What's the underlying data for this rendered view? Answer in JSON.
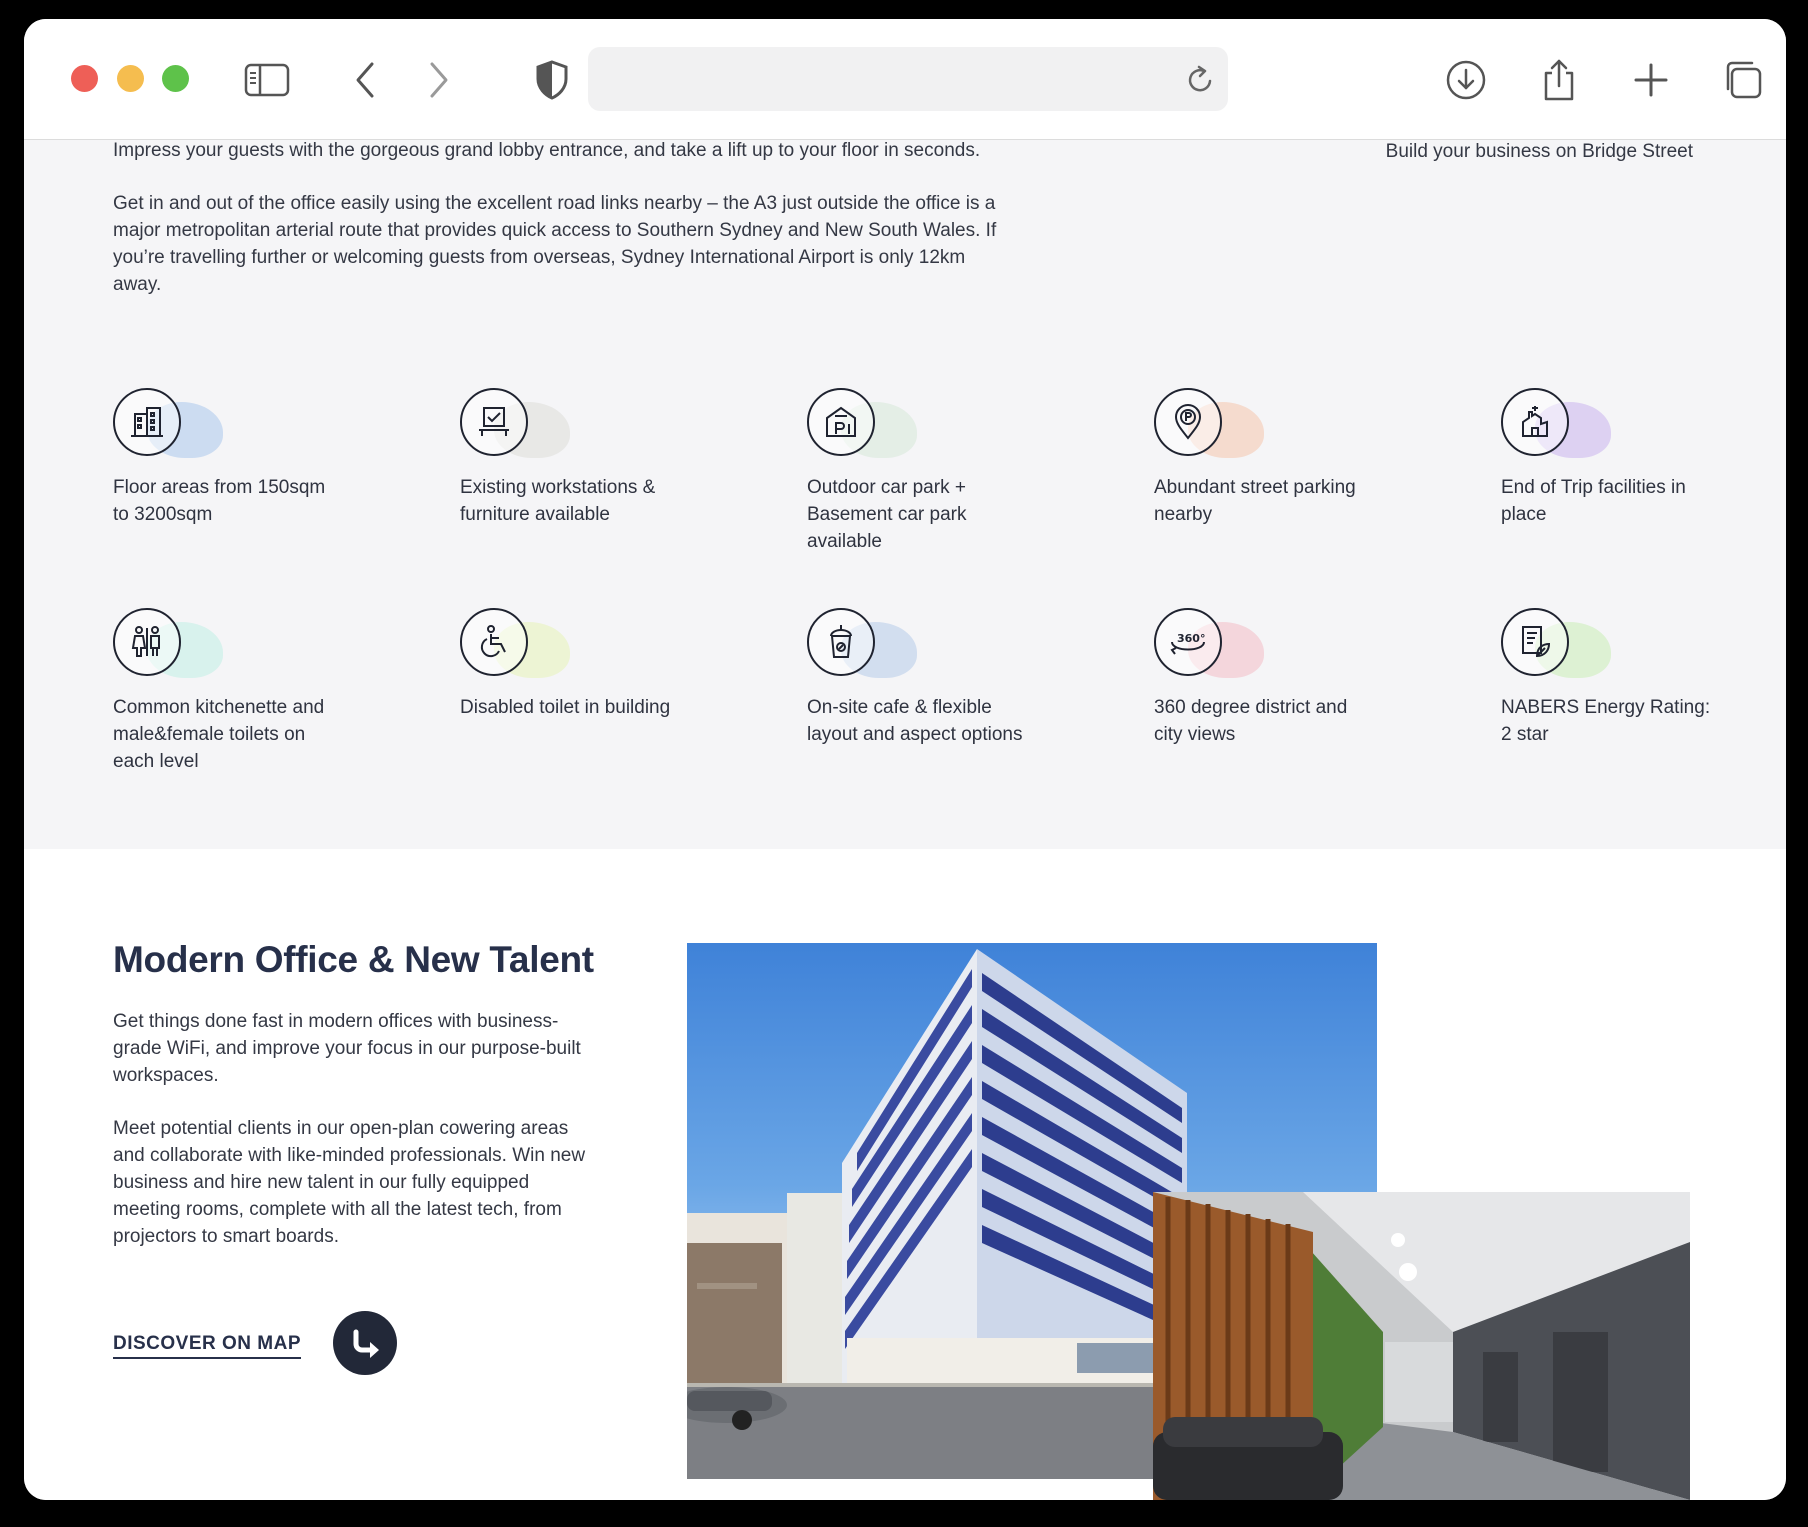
{
  "browser": {
    "url": "",
    "icons": [
      "sidebar-icon",
      "back-icon",
      "forward-icon",
      "privacy-shield-icon",
      "reload-icon",
      "download-icon",
      "share-icon",
      "new-tab-icon",
      "tabs-overview-icon"
    ]
  },
  "intro": {
    "paragraph1": "Impress your guests with the gorgeous grand lobby entrance, and take a lift up to your floor in seconds.",
    "paragraph2": "Get in and out of the office easily using the excellent road links nearby – the A3 just outside the office is a major metropolitan arterial route that provides quick access to Southern Sydney and New South Wales. If you’re travelling further or welcoming guests from overseas, Sydney International Airport is only 12km away.",
    "side_note": "Build your business on Bridge Street"
  },
  "features": [
    {
      "label": "Floor areas from 150sqm to 3200sqm",
      "icon": "building-icon",
      "color": "#a9c6ec"
    },
    {
      "label": "Existing workstations & furniture available",
      "icon": "workstation-icon",
      "color": "#dcdcd8"
    },
    {
      "label": "Outdoor car park + Basement car park available",
      "icon": "car-park-icon",
      "color": "#d6e8d9"
    },
    {
      "label": "Abundant street parking nearby",
      "icon": "parking-pin-icon",
      "color": "#f4c5ad"
    },
    {
      "label": "End of Trip facilities in place",
      "icon": "facilities-icon",
      "color": "#c9b3ef"
    },
    {
      "label": "Common kitchenette and male&female toilets on each level",
      "icon": "toilets-icon",
      "color": "#bfeee6"
    },
    {
      "label": "Disabled toilet in building",
      "icon": "wheelchair-icon",
      "color": "#e5f3b8"
    },
    {
      "label": "On-site cafe & flexible layout and aspect options",
      "icon": "cafe-cup-icon",
      "color": "#b5cbea"
    },
    {
      "label": "360 degree district and city views",
      "icon": "360-view-icon",
      "color": "#f2bcc6"
    },
    {
      "label": "NABERS Energy Rating: 2 star",
      "icon": "energy-rating-icon",
      "color": "#c8ecb6"
    }
  ],
  "modern_office": {
    "title": "Modern Office & New Talent",
    "paragraph1": "Get things done fast in modern offices with business-grade WiFi, and improve your focus in our purpose-built workspaces.",
    "paragraph2": "Meet potential clients in our open-plan cowering areas and collaborate with like-minded professionals. Win new business and hire new talent in our fully equipped meeting rooms, complete with all the latest tech, from projectors to smart boards.",
    "cta_label": "DISCOVER ON MAP",
    "cta_icon": "arrow-turn-icon"
  }
}
